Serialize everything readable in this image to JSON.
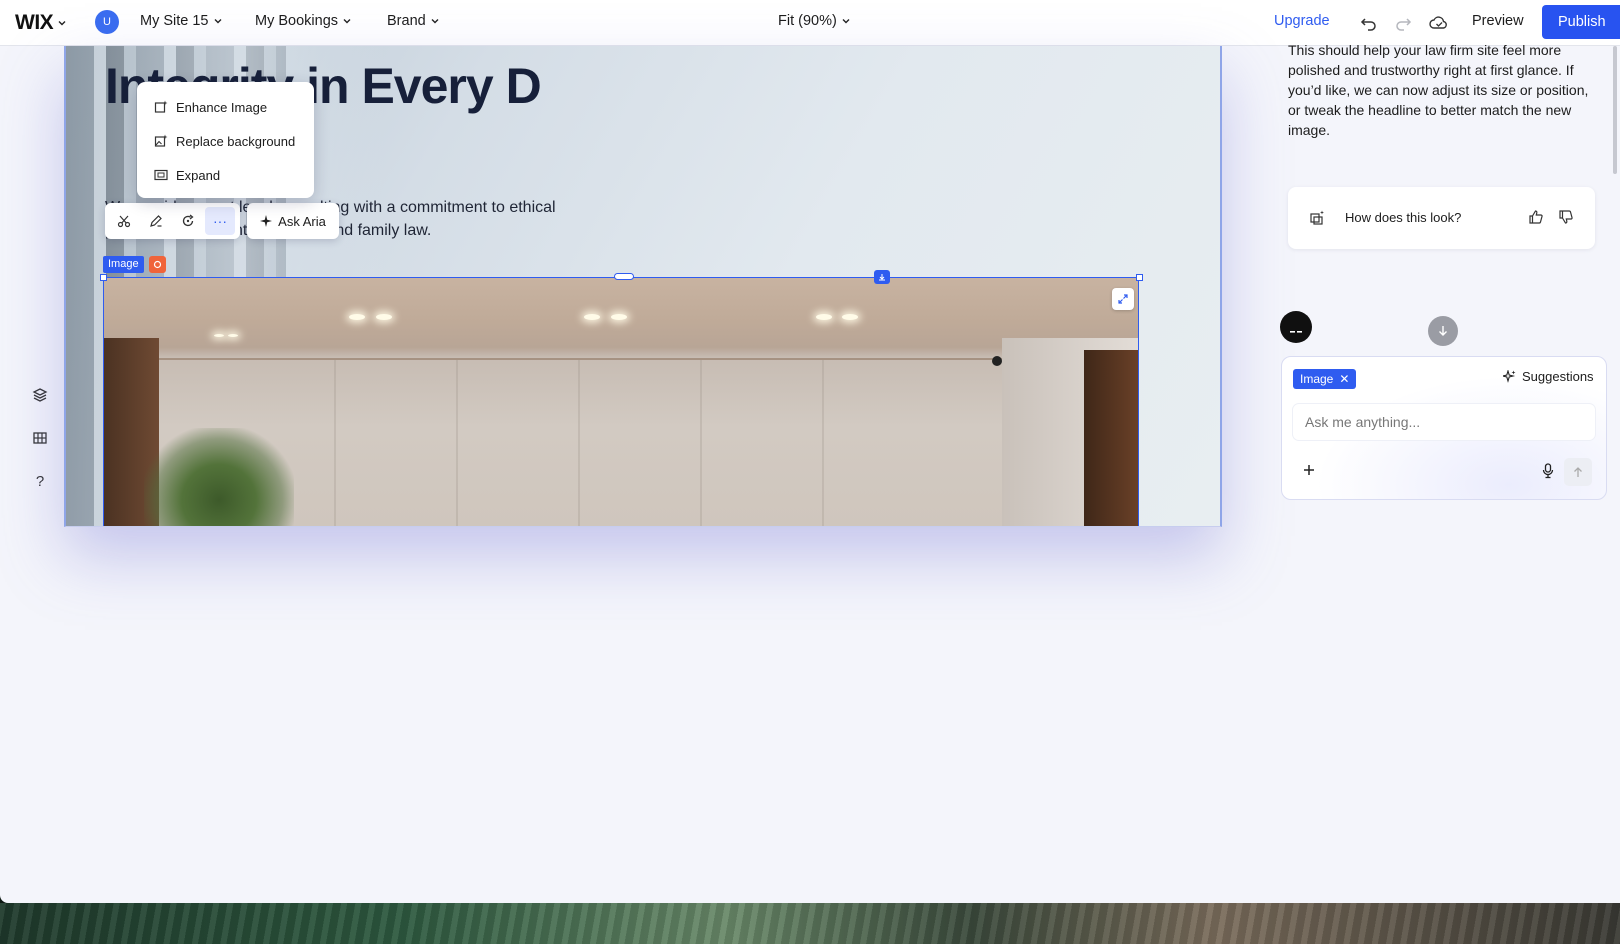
{
  "topbar": {
    "logo": "WIX",
    "avatar_letter": "U",
    "site_name": "My Site 15",
    "bookings": "My Bookings",
    "brand": "Brand",
    "zoom": "Fit (90%)",
    "upgrade": "Upgrade",
    "preview": "Preview",
    "publish": "Publish"
  },
  "left_rail": {
    "help": "?"
  },
  "canvas": {
    "headline": "Integrity in Every D",
    "body_line1": "We provide expert legal consulting with a commitment to ethical",
    "body_line2": "practice across contract, labor, and family law.",
    "selection_label": "Image"
  },
  "context_menu": {
    "items": [
      {
        "label": "Enhance Image",
        "icon": "enhance-icon"
      },
      {
        "label": "Replace background",
        "icon": "replace-background-icon"
      },
      {
        "label": "Expand",
        "icon": "expand-icon"
      }
    ]
  },
  "floating_toolbar": {
    "more": "···",
    "ask_aria": "Ask Aria"
  },
  "chat": {
    "message": "This should help your law firm site feel more polished and trustworthy right at first glance. If you’d like, we can now adjust its size or position, or tweak the headline to better match the new image.",
    "feedback_prompt": "How does this look?",
    "chip_label": "Image",
    "suggestions": "Suggestions",
    "input_placeholder": "Ask me anything..."
  },
  "colors": {
    "accent": "#2f5cf0",
    "publish_bg": "#2853f0",
    "selection": "#2f5cf0",
    "orange_badge": "#f0643a"
  }
}
